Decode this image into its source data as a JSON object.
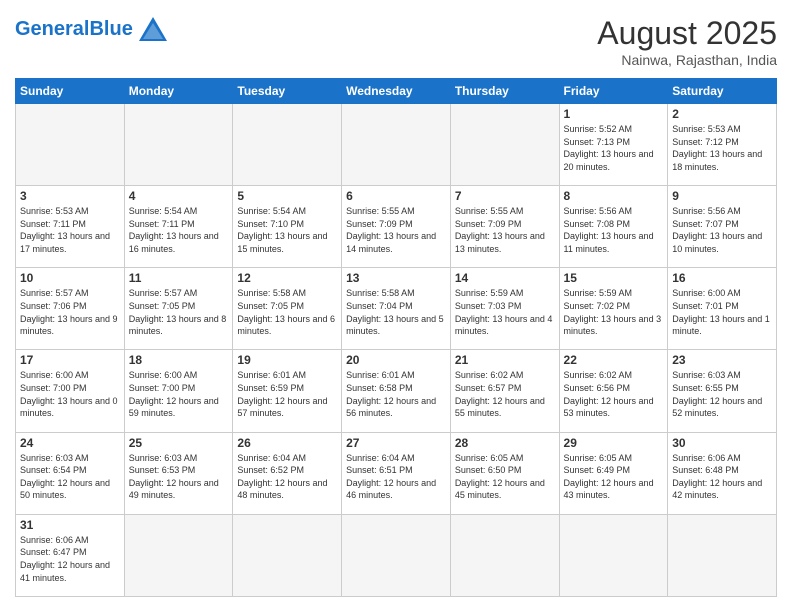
{
  "header": {
    "logo_general": "General",
    "logo_blue": "Blue",
    "month_title": "August 2025",
    "subtitle": "Nainwa, Rajasthan, India"
  },
  "days_of_week": [
    "Sunday",
    "Monday",
    "Tuesday",
    "Wednesday",
    "Thursday",
    "Friday",
    "Saturday"
  ],
  "weeks": [
    [
      {
        "day": "",
        "info": ""
      },
      {
        "day": "",
        "info": ""
      },
      {
        "day": "",
        "info": ""
      },
      {
        "day": "",
        "info": ""
      },
      {
        "day": "",
        "info": ""
      },
      {
        "day": "1",
        "info": "Sunrise: 5:52 AM\nSunset: 7:13 PM\nDaylight: 13 hours and 20 minutes."
      },
      {
        "day": "2",
        "info": "Sunrise: 5:53 AM\nSunset: 7:12 PM\nDaylight: 13 hours and 18 minutes."
      }
    ],
    [
      {
        "day": "3",
        "info": "Sunrise: 5:53 AM\nSunset: 7:11 PM\nDaylight: 13 hours and 17 minutes."
      },
      {
        "day": "4",
        "info": "Sunrise: 5:54 AM\nSunset: 7:11 PM\nDaylight: 13 hours and 16 minutes."
      },
      {
        "day": "5",
        "info": "Sunrise: 5:54 AM\nSunset: 7:10 PM\nDaylight: 13 hours and 15 minutes."
      },
      {
        "day": "6",
        "info": "Sunrise: 5:55 AM\nSunset: 7:09 PM\nDaylight: 13 hours and 14 minutes."
      },
      {
        "day": "7",
        "info": "Sunrise: 5:55 AM\nSunset: 7:09 PM\nDaylight: 13 hours and 13 minutes."
      },
      {
        "day": "8",
        "info": "Sunrise: 5:56 AM\nSunset: 7:08 PM\nDaylight: 13 hours and 11 minutes."
      },
      {
        "day": "9",
        "info": "Sunrise: 5:56 AM\nSunset: 7:07 PM\nDaylight: 13 hours and 10 minutes."
      }
    ],
    [
      {
        "day": "10",
        "info": "Sunrise: 5:57 AM\nSunset: 7:06 PM\nDaylight: 13 hours and 9 minutes."
      },
      {
        "day": "11",
        "info": "Sunrise: 5:57 AM\nSunset: 7:05 PM\nDaylight: 13 hours and 8 minutes."
      },
      {
        "day": "12",
        "info": "Sunrise: 5:58 AM\nSunset: 7:05 PM\nDaylight: 13 hours and 6 minutes."
      },
      {
        "day": "13",
        "info": "Sunrise: 5:58 AM\nSunset: 7:04 PM\nDaylight: 13 hours and 5 minutes."
      },
      {
        "day": "14",
        "info": "Sunrise: 5:59 AM\nSunset: 7:03 PM\nDaylight: 13 hours and 4 minutes."
      },
      {
        "day": "15",
        "info": "Sunrise: 5:59 AM\nSunset: 7:02 PM\nDaylight: 13 hours and 3 minutes."
      },
      {
        "day": "16",
        "info": "Sunrise: 6:00 AM\nSunset: 7:01 PM\nDaylight: 13 hours and 1 minute."
      }
    ],
    [
      {
        "day": "17",
        "info": "Sunrise: 6:00 AM\nSunset: 7:00 PM\nDaylight: 13 hours and 0 minutes."
      },
      {
        "day": "18",
        "info": "Sunrise: 6:00 AM\nSunset: 7:00 PM\nDaylight: 12 hours and 59 minutes."
      },
      {
        "day": "19",
        "info": "Sunrise: 6:01 AM\nSunset: 6:59 PM\nDaylight: 12 hours and 57 minutes."
      },
      {
        "day": "20",
        "info": "Sunrise: 6:01 AM\nSunset: 6:58 PM\nDaylight: 12 hours and 56 minutes."
      },
      {
        "day": "21",
        "info": "Sunrise: 6:02 AM\nSunset: 6:57 PM\nDaylight: 12 hours and 55 minutes."
      },
      {
        "day": "22",
        "info": "Sunrise: 6:02 AM\nSunset: 6:56 PM\nDaylight: 12 hours and 53 minutes."
      },
      {
        "day": "23",
        "info": "Sunrise: 6:03 AM\nSunset: 6:55 PM\nDaylight: 12 hours and 52 minutes."
      }
    ],
    [
      {
        "day": "24",
        "info": "Sunrise: 6:03 AM\nSunset: 6:54 PM\nDaylight: 12 hours and 50 minutes."
      },
      {
        "day": "25",
        "info": "Sunrise: 6:03 AM\nSunset: 6:53 PM\nDaylight: 12 hours and 49 minutes."
      },
      {
        "day": "26",
        "info": "Sunrise: 6:04 AM\nSunset: 6:52 PM\nDaylight: 12 hours and 48 minutes."
      },
      {
        "day": "27",
        "info": "Sunrise: 6:04 AM\nSunset: 6:51 PM\nDaylight: 12 hours and 46 minutes."
      },
      {
        "day": "28",
        "info": "Sunrise: 6:05 AM\nSunset: 6:50 PM\nDaylight: 12 hours and 45 minutes."
      },
      {
        "day": "29",
        "info": "Sunrise: 6:05 AM\nSunset: 6:49 PM\nDaylight: 12 hours and 43 minutes."
      },
      {
        "day": "30",
        "info": "Sunrise: 6:06 AM\nSunset: 6:48 PM\nDaylight: 12 hours and 42 minutes."
      }
    ],
    [
      {
        "day": "31",
        "info": "Sunrise: 6:06 AM\nSunset: 6:47 PM\nDaylight: 12 hours and 41 minutes."
      },
      {
        "day": "",
        "info": ""
      },
      {
        "day": "",
        "info": ""
      },
      {
        "day": "",
        "info": ""
      },
      {
        "day": "",
        "info": ""
      },
      {
        "day": "",
        "info": ""
      },
      {
        "day": "",
        "info": ""
      }
    ]
  ]
}
